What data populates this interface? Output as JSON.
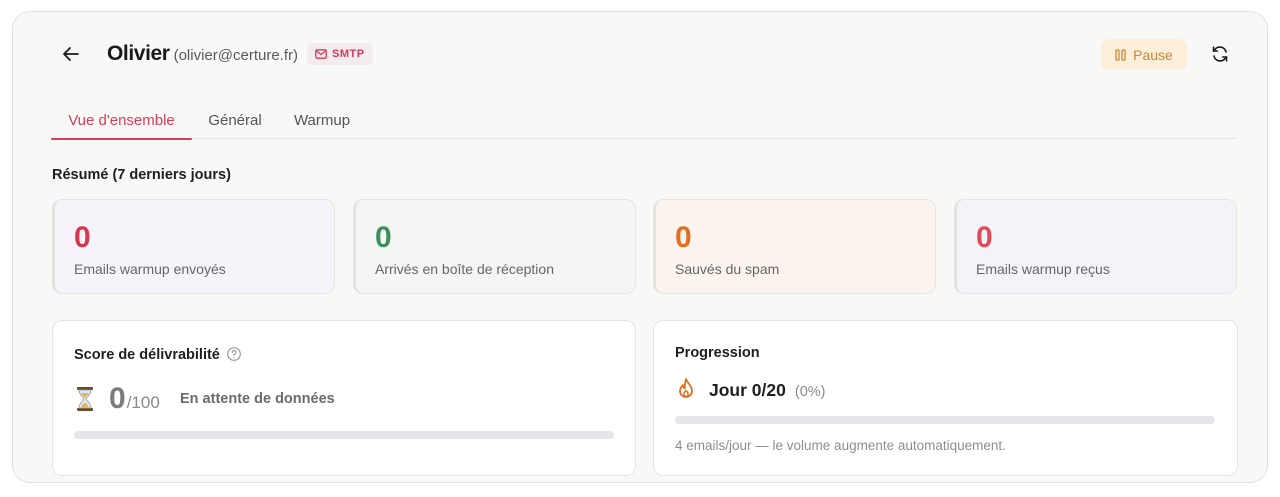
{
  "header": {
    "name": "Olivier",
    "email": "(olivier@certure.fr)",
    "badge": "SMTP",
    "pause_label": "Pause"
  },
  "tabs": [
    {
      "label": "Vue d'ensemble",
      "active": true
    },
    {
      "label": "Général",
      "active": false
    },
    {
      "label": "Warmup",
      "active": false
    }
  ],
  "summary": {
    "title": "Résumé (7 derniers jours)",
    "stats": [
      {
        "value": "0",
        "label": "Emails warmup envoyés",
        "color": "#d3394f"
      },
      {
        "value": "0",
        "label": "Arrivés en boîte de réception",
        "color": "#3e8f5e"
      },
      {
        "value": "0",
        "label": "Sauvés du spam",
        "color": "#e0701f"
      },
      {
        "value": "0",
        "label": "Emails warmup reçus",
        "color": "#e04a5a"
      }
    ]
  },
  "deliverability": {
    "title": "Score de délivrabilité",
    "score": "0",
    "max": "/100",
    "status": "En attente de données",
    "progress": 0
  },
  "progression": {
    "title": "Progression",
    "day": "Jour 0/20",
    "percent": "(0%)",
    "progress": 0,
    "note": "4 emails/jour — le volume augmente automatiquement."
  },
  "icons": {
    "back": "arrow-left-icon",
    "badge": "mail-icon",
    "pause": "pause-icon",
    "refresh": "refresh-icon",
    "help": "help-circle-icon",
    "waiting": "hourglass-icon",
    "progression": "flame-icon"
  },
  "colors": {
    "accent": "#d93c57",
    "pause_bg": "#fbefd9",
    "pause_text": "#c9873a",
    "flame": "#e0701f"
  }
}
